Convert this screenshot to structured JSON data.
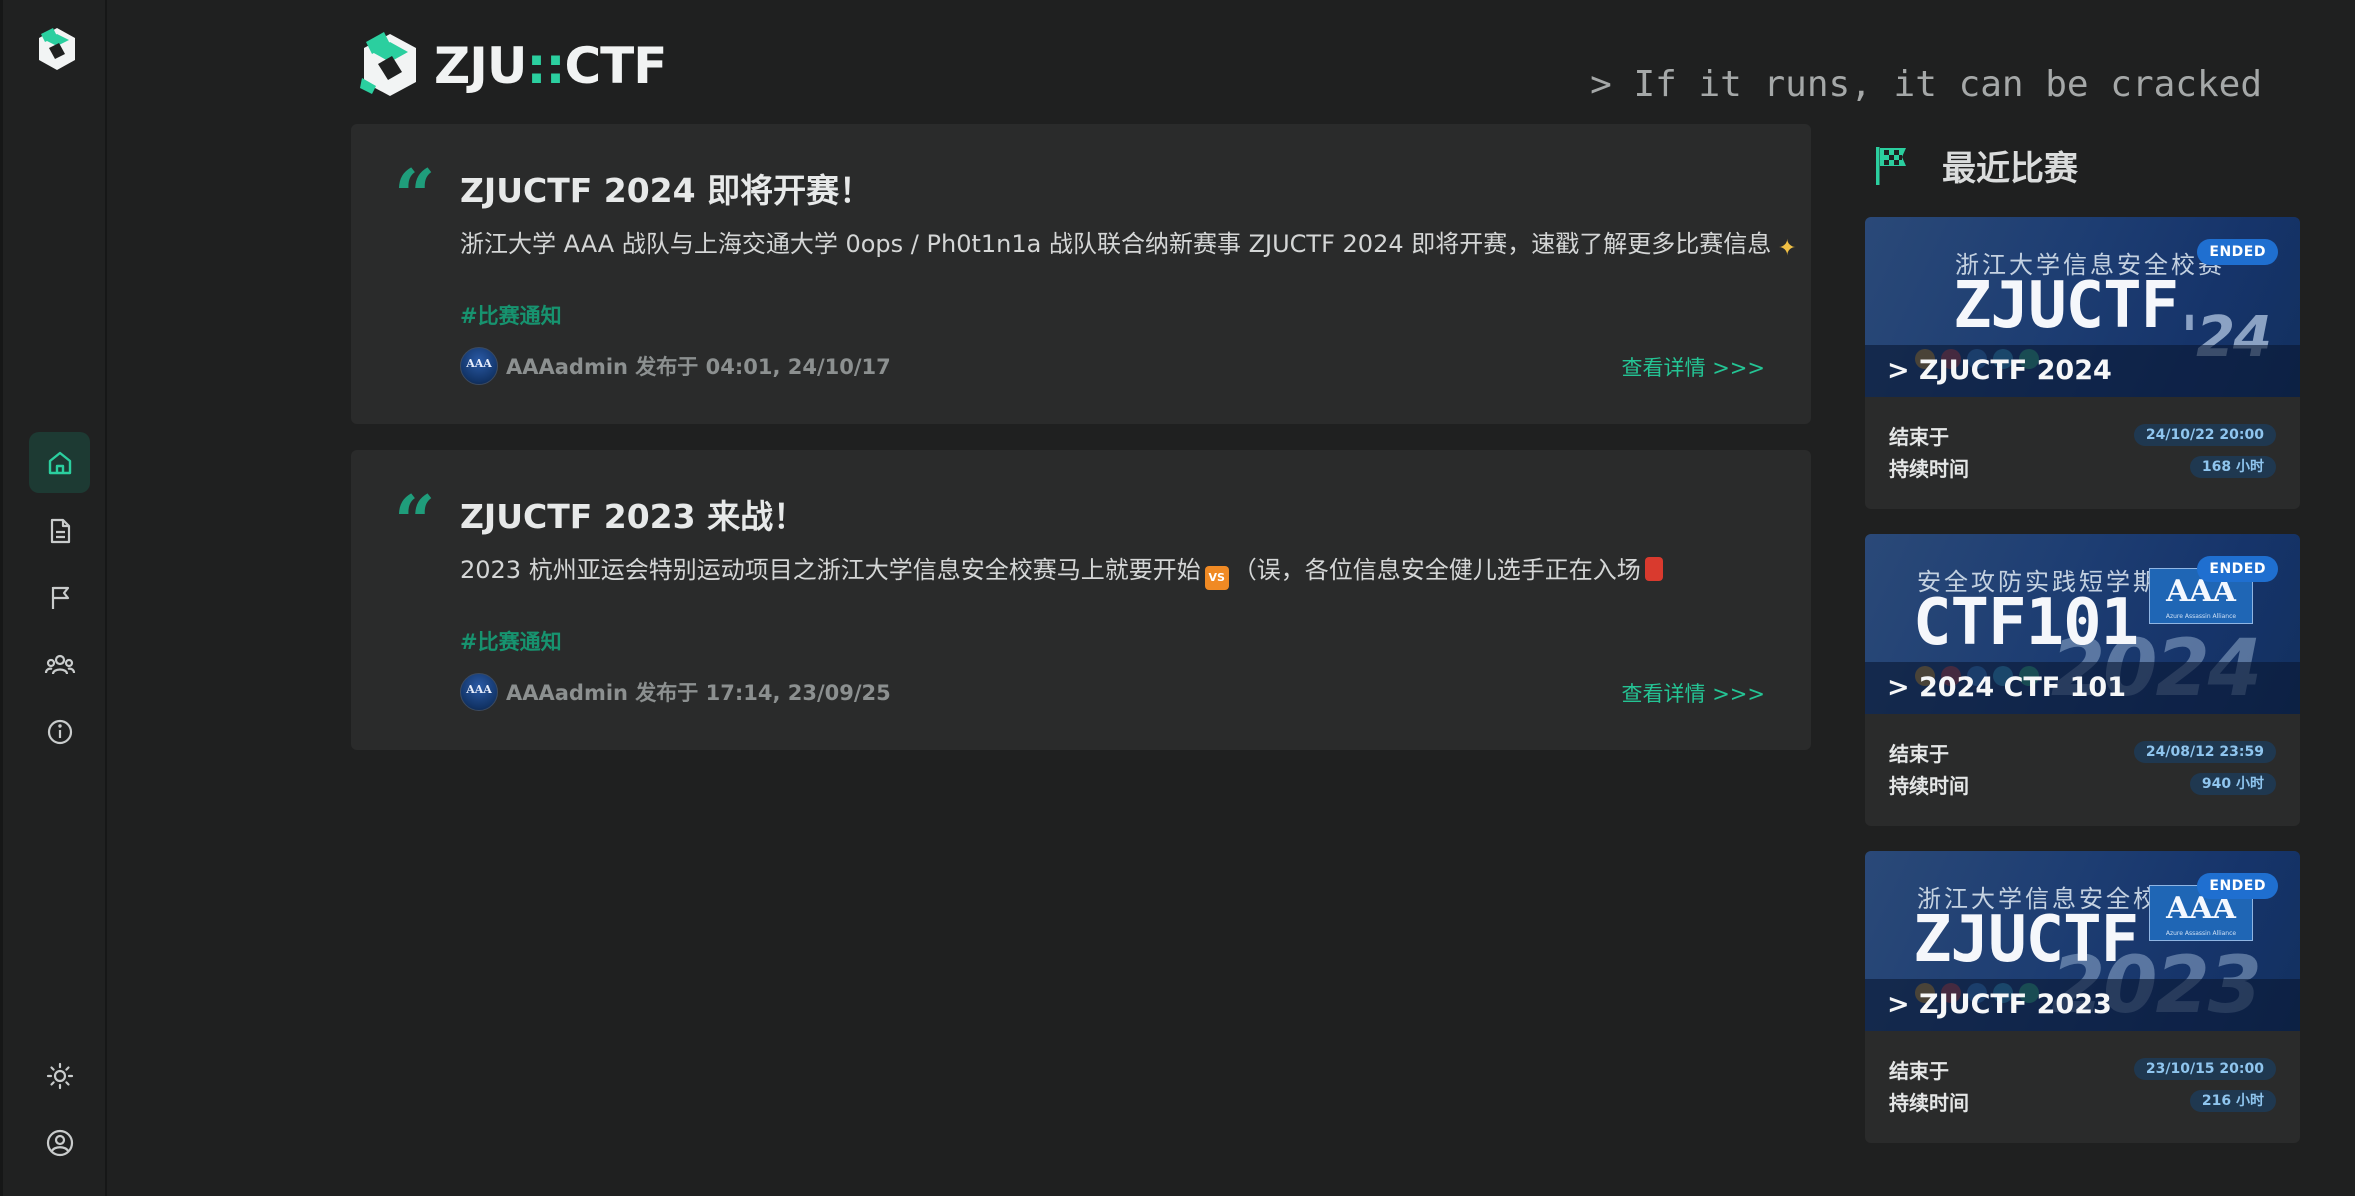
{
  "brand": {
    "name_left": "ZJU",
    "name_sep": "::",
    "name_right": "CTF",
    "tagline": "> If it runs, it can be cracked"
  },
  "nav": {
    "items": [
      {
        "name": "home",
        "icon": "home-icon",
        "active": true
      },
      {
        "name": "posts",
        "icon": "document-icon",
        "active": false
      },
      {
        "name": "contests",
        "icon": "flag-icon",
        "active": false
      },
      {
        "name": "teams",
        "icon": "users-icon",
        "active": false
      },
      {
        "name": "about",
        "icon": "info-icon",
        "active": false
      }
    ],
    "bottom": [
      {
        "name": "theme-toggle",
        "icon": "brightness-icon"
      },
      {
        "name": "account",
        "icon": "user-circle-icon"
      }
    ]
  },
  "posts": [
    {
      "title": "ZJUCTF 2024 即将开赛！",
      "desc_main": "浙江大学 AAA 战队与上海交通大学 0ops / Ph0t1n1a 战队联合纳新赛事 ZJUCTF 2024 即将开赛，速戳了解更多比赛信息",
      "tag": "#比赛通知",
      "avatar_text": "AAA",
      "author_line": "AAAadmin 发布于 04:01, 24/10/17",
      "link": "查看详情 >>>"
    },
    {
      "title": "ZJUCTF 2023 来战！",
      "desc_part1": "2023 杭州亚运会特别运动项目之浙江大学信息安全校赛马上就要开始",
      "desc_part2": "（误，各位信息安全健儿选手正在入场",
      "vs_label": "VS",
      "tag": "#比赛通知",
      "avatar_text": "AAA",
      "author_line": "AAAadmin 发布于 17:14, 23/09/25",
      "link": "查看详情 >>>"
    }
  ],
  "recent": {
    "title": "最近比赛",
    "contests": [
      {
        "banner_sub": "浙江大学信息安全校赛",
        "banner_big": "ZJUCTF",
        "banner_year": "'24",
        "show_aaa": false,
        "title": "> ZJUCTF 2024",
        "status": "ENDED",
        "end_label": "结束于",
        "end_value": "24/10/22 20:00",
        "duration_label": "持续时间",
        "duration_value": "168 小时"
      },
      {
        "banner_sub": "安全攻防实践短学期",
        "banner_big": "CTF101",
        "banner_year": "2024",
        "show_aaa": true,
        "aaa_text": "AAA",
        "aaa_sub": "Azure Assassin Alliance",
        "title": "> 2024 CTF 101",
        "status": "ENDED",
        "end_label": "结束于",
        "end_value": "24/08/12 23:59",
        "duration_label": "持续时间",
        "duration_value": "940 小时"
      },
      {
        "banner_sub": "浙江大学信息安全校赛",
        "banner_big": "ZJUCTF",
        "banner_year": "2023",
        "show_aaa": true,
        "aaa_text": "AAA",
        "aaa_sub": "Azure Assassin Alliance",
        "title": "> ZJUCTF 2023",
        "status": "ENDED",
        "end_label": "结束于",
        "end_value": "23/10/15 20:00",
        "duration_label": "持续时间",
        "duration_value": "216 小时"
      }
    ]
  },
  "colors": {
    "accent": "#24c494",
    "background": "#1f2020",
    "card": "#2a2b2b",
    "badge": "#1f6fd0"
  }
}
